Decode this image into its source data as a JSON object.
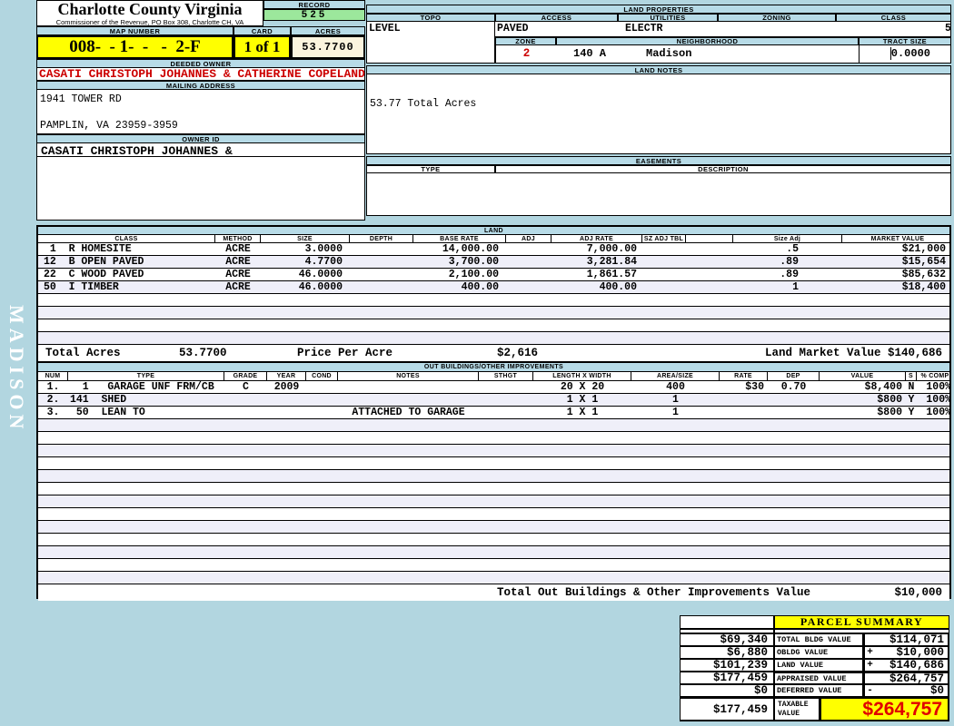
{
  "header": {
    "county": "Charlotte County Virginia",
    "commissioner": "Commissioner of the Revenue, PO Box 308, Charlotte CH, VA",
    "record_label": "RECORD",
    "record_value": "525",
    "map_number_label": "MAP NUMBER",
    "map_number": "008-  - 1-  -   -  2-F",
    "card_label": "CARD",
    "card_value": "1 of 1",
    "acres_label": "ACRES",
    "acres_value": "53.7700"
  },
  "owner": {
    "deeded_owner_label": "DEEDED OWNER",
    "deeded_owner": "CASATI CHRISTOPH JOHANNES & CATHERINE COPELAND",
    "mailing_address_label": "MAILING ADDRESS",
    "address_line1": "1941 TOWER RD",
    "address_line2": "PAMPLIN, VA 23959-3959",
    "owner_id_label": "OWNER ID",
    "owner_id": "CASATI CHRISTOPH JOHANNES &"
  },
  "land_properties": {
    "title": "LAND PROPERTIES",
    "topo_label": "TOPO",
    "topo": "LEVEL",
    "access_label": "ACCESS",
    "access": "PAVED",
    "utilities_label": "UTILITIES",
    "utilities": "ELECTR",
    "zoning_label": "ZONING",
    "zoning": "",
    "class_label": "CLASS",
    "class": "5",
    "zone_label": "ZONE",
    "zone": "2",
    "neighborhood_label": "NEIGHBORHOOD",
    "neighborhood_code": "140 A",
    "neighborhood": "Madison",
    "tract_size_label": "TRACT SIZE",
    "tract_size": "0.0000"
  },
  "land_notes": {
    "title": "LAND NOTES",
    "note": "53.77 Total Acres"
  },
  "easements": {
    "title": "EASEMENTS",
    "type_label": "TYPE",
    "description_label": "DESCRIPTION"
  },
  "land_table": {
    "title": "LAND",
    "columns": [
      "CLASS",
      "METHOD",
      "SIZE",
      "DEPTH",
      "BASE RATE",
      "ADJ",
      "ADJ RATE",
      "SZ ADJ TBL",
      "",
      "Size Adj",
      "MARKET VALUE"
    ],
    "rows": [
      {
        "class": " 1  R HOMESITE",
        "method": "ACRE",
        "size": "3.0000",
        "depth": "",
        "base_rate": "14,000.00",
        "adj": "",
        "adj_rate": "7,000.00",
        "sz_adj_tbl": "",
        "blank": "",
        "size_adj": ".5",
        "market_value": "$21,000"
      },
      {
        "class": "12  B OPEN PAVED",
        "method": "ACRE",
        "size": "4.7700",
        "depth": "",
        "base_rate": "3,700.00",
        "adj": "",
        "adj_rate": "3,281.84",
        "sz_adj_tbl": "",
        "blank": "",
        "size_adj": ".89",
        "market_value": "$15,654"
      },
      {
        "class": "22  C WOOD PAVED",
        "method": "ACRE",
        "size": "46.0000",
        "depth": "",
        "base_rate": "2,100.00",
        "adj": "",
        "adj_rate": "1,861.57",
        "sz_adj_tbl": "",
        "blank": "",
        "size_adj": ".89",
        "market_value": "$85,632"
      },
      {
        "class": "50  I TIMBER",
        "method": "ACRE",
        "size": "46.0000",
        "depth": "",
        "base_rate": "400.00",
        "adj": "",
        "adj_rate": "400.00",
        "sz_adj_tbl": "",
        "blank": "",
        "size_adj": "1",
        "market_value": "$18,400"
      }
    ],
    "empty_rows": 4,
    "totals": {
      "total_acres_label": "Total Acres",
      "total_acres": "53.7700",
      "price_per_acre_label": "Price Per Acre",
      "price_per_acre": "$2,616",
      "land_market_value_label": "Land Market Value",
      "land_market_value": "$140,686"
    }
  },
  "out_buildings": {
    "title": "OUT BUILDINGS/OTHER IMPROVEMENTS",
    "columns": [
      "NUM",
      "TYPE",
      "GRADE",
      "YEAR",
      "COND",
      "NOTES",
      "STHGT",
      "LENGTH X WIDTH",
      "AREA/SIZE",
      "RATE",
      "DEP",
      "VALUE",
      "S",
      "% COMP"
    ],
    "rows": [
      {
        "num": "1.",
        "type": "  1   GARAGE UNF FRM/CB",
        "grade": "C",
        "year": "2009",
        "cond": "",
        "notes": "",
        "sthgt": "",
        "lxw": "20 X 20",
        "area": "400",
        "rate": "$30",
        "dep": "0.70",
        "value": "$8,400",
        "s": "N",
        "comp": "100%"
      },
      {
        "num": "2.",
        "type": "141  SHED",
        "grade": "",
        "year": "",
        "cond": "",
        "notes": "",
        "sthgt": "",
        "lxw": "1 X 1",
        "area": "1",
        "rate": "",
        "dep": "",
        "value": "$800",
        "s": "Y",
        "comp": "100%"
      },
      {
        "num": "3.",
        "type": " 50  LEAN TO",
        "grade": "",
        "year": "",
        "cond": "",
        "notes": "ATTACHED TO GARAGE",
        "sthgt": "",
        "lxw": "1 X 1",
        "area": "1",
        "rate": "",
        "dep": "",
        "value": "$800",
        "s": "Y",
        "comp": "100%"
      }
    ],
    "empty_rows": 13,
    "total_label": "Total Out Buildings & Other Improvements Value",
    "total_value": "$10,000"
  },
  "parcel_summary": {
    "title": "PARCEL SUMMARY",
    "rows": [
      {
        "prior": "$69,340",
        "label": "TOTAL BLDG VALUE",
        "op": "",
        "value": "$114,071"
      },
      {
        "prior": "$6,880",
        "label": "OBLDG VALUE",
        "op": "+",
        "value": "$10,000"
      },
      {
        "prior": "$101,239",
        "label": "LAND VALUE",
        "op": "+",
        "value": "$140,686"
      },
      {
        "prior": "$177,459",
        "label": "APPRAISED VALUE",
        "op": "",
        "value": "$264,757"
      },
      {
        "prior": "$0",
        "label": "DEFERRED VALUE",
        "op": "-",
        "value": "$0"
      }
    ],
    "taxable": {
      "prior": "$177,459",
      "label": "TAXABLE VALUE",
      "value": "$264,757"
    }
  },
  "watermark": "MADISON",
  "colors": {
    "page_background": "#B2D6E0",
    "header_bar": "#B7DBE7",
    "record_green": "#9CE79C",
    "highlight_yellow": "#FFFF00",
    "acres_cream": "#FBF4DE",
    "alt_row": "#EFEFF9",
    "owner_red": "#CC0000",
    "taxable_red": "#E00000"
  }
}
